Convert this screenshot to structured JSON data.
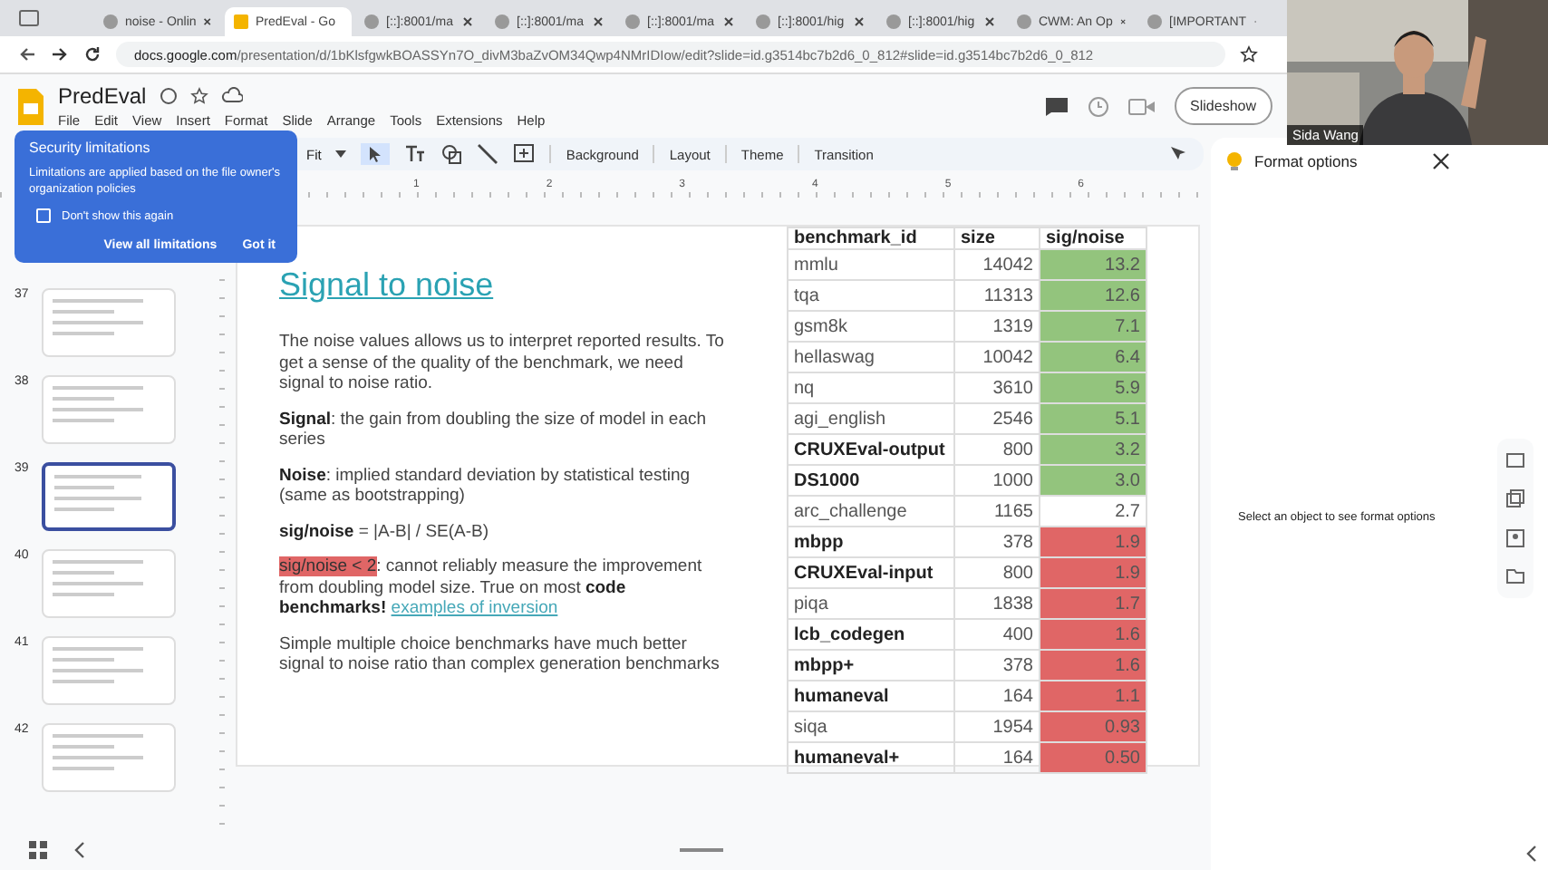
{
  "browser": {
    "tabs": [
      {
        "title": "noise - Onlin",
        "selected": false
      },
      {
        "title": "PredEval - Go",
        "selected": true
      },
      {
        "title": "[::]:8001/ma",
        "selected": false
      },
      {
        "title": "[::]:8001/ma",
        "selected": false
      },
      {
        "title": "[::]:8001/ma",
        "selected": false
      },
      {
        "title": "[::]:8001/hig",
        "selected": false
      },
      {
        "title": "[::]:8001/hig",
        "selected": false
      },
      {
        "title": "CWM: An Op",
        "selected": false
      },
      {
        "title": "[IMPORTANT",
        "selected": false
      }
    ],
    "url_host": "docs.google.com",
    "url_path": "/presentation/d/1bKlsfgwkBOASSYn7O_divM3baZvOM34Qwp4NMrIDIow/edit?slide=id.g3514bc7b2d6_0_812#slide=id.g3514bc7b2d6_0_812"
  },
  "document": {
    "title": "PredEval",
    "menu": [
      "File",
      "Edit",
      "View",
      "Insert",
      "Format",
      "Slide",
      "Arrange",
      "Tools",
      "Extensions",
      "Help"
    ],
    "slideshow_button": "Slideshow"
  },
  "toolbar": {
    "zoom": "Fit",
    "buttons": [
      "Background",
      "Layout",
      "Theme",
      "Transition"
    ]
  },
  "ruler": [
    "1",
    "2",
    "3",
    "4",
    "5",
    "6"
  ],
  "popup": {
    "title": "Security limitations",
    "message": "Limitations are applied based on the file owner's organization policies",
    "checkbox": {
      "label": "Don't show this again",
      "checked": false
    },
    "actions": [
      "View all limitations",
      "Got it"
    ]
  },
  "thumbnails": [
    {
      "number": "37",
      "selected": false
    },
    {
      "number": "38",
      "selected": false
    },
    {
      "number": "39",
      "selected": true
    },
    {
      "number": "40",
      "selected": false
    },
    {
      "number": "41",
      "selected": false
    },
    {
      "number": "42",
      "selected": false
    }
  ],
  "slide": {
    "title": "Signal to noise",
    "paragraphs": [
      "The noise values allows us to interpret reported results. To get a sense of the quality of the benchmark, we need signal to noise ratio.",
      "**Signal**: the gain from doubling the size of model in each series",
      "**Noise**: implied standard deviation by statistical testing (same as bootstrapping)",
      "**sig/noise** = |A-B| / SE(A-B)"
    ],
    "warning": {
      "highlight": "sig/noise < 2",
      "text": ": cannot reliably measure the improvement from doubling model size. True on most **code benchmarks!**",
      "link": "examples of inversion"
    },
    "closing": "Simple multiple choice benchmarks have much better signal to noise ratio than complex generation benchmarks",
    "table": {
      "columns": [
        "benchmark_id",
        "size",
        "sig/noise"
      ],
      "rows": [
        {
          "id": "mmlu",
          "size": "14042",
          "ratio": "13.2",
          "bold": false,
          "color": "#93c47d"
        },
        {
          "id": "tqa",
          "size": "11313",
          "ratio": "12.6",
          "bold": false,
          "color": "#93c47d"
        },
        {
          "id": "gsm8k",
          "size": "1319",
          "ratio": "7.1",
          "bold": false,
          "color": "#93c47d"
        },
        {
          "id": "hellaswag",
          "size": "10042",
          "ratio": "6.4",
          "bold": false,
          "color": "#93c47d"
        },
        {
          "id": "nq",
          "size": "3610",
          "ratio": "5.9",
          "bold": false,
          "color": "#93c47d"
        },
        {
          "id": "agi_english",
          "size": "2546",
          "ratio": "5.1",
          "bold": false,
          "color": "#93c47d"
        },
        {
          "id": "CRUXEval-output",
          "size": "800",
          "ratio": "3.2",
          "bold": true,
          "color": "#93c47d"
        },
        {
          "id": "DS1000",
          "size": "1000",
          "ratio": "3.0",
          "bold": true,
          "color": "#93c47d"
        },
        {
          "id": "arc_challenge",
          "size": "1165",
          "ratio": "2.7",
          "bold": false,
          "color": "#ffffff"
        },
        {
          "id": "mbpp",
          "size": "378",
          "ratio": "1.9",
          "bold": true,
          "color": "#e06666"
        },
        {
          "id": "CRUXEval-input",
          "size": "800",
          "ratio": "1.9",
          "bold": true,
          "color": "#e06666"
        },
        {
          "id": "piqa",
          "size": "1838",
          "ratio": "1.7",
          "bold": false,
          "color": "#e06666"
        },
        {
          "id": "lcb_codegen",
          "size": "400",
          "ratio": "1.6",
          "bold": true,
          "color": "#e06666"
        },
        {
          "id": "mbpp+",
          "size": "378",
          "ratio": "1.6",
          "bold": true,
          "color": "#e06666"
        },
        {
          "id": "humaneval",
          "size": "164",
          "ratio": "1.1",
          "bold": true,
          "color": "#e06666"
        },
        {
          "id": "siqa",
          "size": "1954",
          "ratio": "0.93",
          "bold": false,
          "color": "#e06666"
        },
        {
          "id": "humaneval+",
          "size": "164",
          "ratio": "0.50",
          "bold": true,
          "color": "#e06666"
        }
      ]
    }
  },
  "format_panel": {
    "title": "Format options",
    "message": "Select an object to see format options"
  },
  "video": {
    "name": "Sida Wang"
  }
}
